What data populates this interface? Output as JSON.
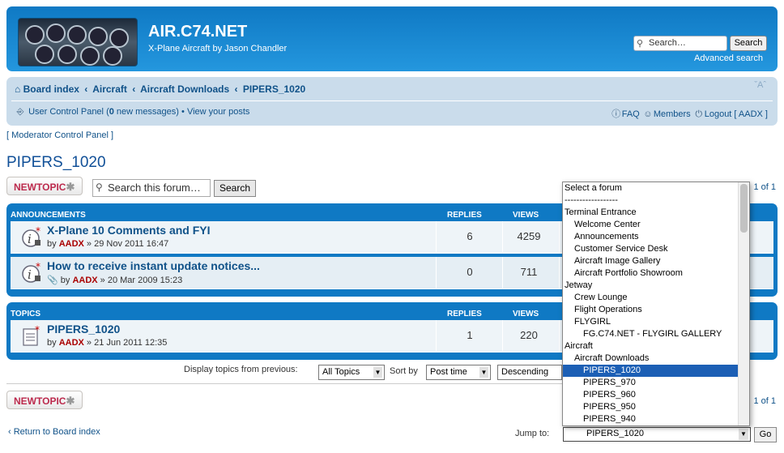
{
  "header": {
    "site_title": "AIR.C74.NET",
    "site_description": "X-Plane Aircraft by Jason Chandler",
    "search_placeholder": "Search…",
    "search_button": "Search",
    "advanced_search": "Advanced search",
    "brand_color": "#0f79c4"
  },
  "breadcrumbs": [
    "Board index",
    "Aircraft",
    "Aircraft Downloads",
    "PIPERS_1020"
  ],
  "font_size_control": "A",
  "nav": {
    "ucp": "User Control Panel",
    "messages_prefix": "(",
    "messages_count": "0",
    "messages_suffix": " new messages)",
    "view_posts": "View your posts",
    "faq": "FAQ",
    "members": "Members",
    "logout": "Logout [ AADX ]"
  },
  "mcp_link": "[ Moderator Control Panel ]",
  "page_title": "PIPERS_1020",
  "newtopic_label": "NEWTOPIC",
  "forum_search_placeholder": "Search this forum…",
  "forum_search_button": "Search",
  "page_of_top": "1 of 1",
  "page_of_bottom": "1 of 1",
  "announcements": {
    "header": "ANNOUNCEMENTS",
    "col_replies": "REPLIES",
    "col_views": "VIEWS",
    "rows": [
      {
        "title": "X-Plane 10 Comments and FYI",
        "by": "by ",
        "author": "AADX",
        "date": " » 29 Nov 2011 16:47",
        "replies": "6",
        "views": "4259"
      },
      {
        "title": "How to receive instant update notices...",
        "by": " by ",
        "author": "AADX",
        "date": " » 20 Mar 2009 15:23",
        "replies": "0",
        "views": "711"
      }
    ]
  },
  "topics": {
    "header": "TOPICS",
    "col_replies": "REPLIES",
    "col_views": "VIEWS",
    "rows": [
      {
        "title": "PIPERS_1020",
        "by": "by ",
        "author": "AADX",
        "date": " » 21 Jun 2011 12:35",
        "replies": "1",
        "views": "220"
      }
    ]
  },
  "display_bar": {
    "label": "Display topics from previous:",
    "topics_value": "All Topics",
    "sort_label": "Sort by",
    "sort_value": "Post time",
    "order_value": "Descending"
  },
  "return_link": "Return to Board index",
  "jump": {
    "label": "Jump to:",
    "selected": "PIPERS_1020",
    "go": "Go",
    "options": [
      {
        "label": "Select a forum",
        "level": 0
      },
      {
        "label": "------------------",
        "level": 0
      },
      {
        "label": "Terminal Entrance",
        "level": 0
      },
      {
        "label": "Welcome Center",
        "level": 1
      },
      {
        "label": "Announcements",
        "level": 1
      },
      {
        "label": "Customer Service Desk",
        "level": 1
      },
      {
        "label": "Aircraft Image Gallery",
        "level": 1
      },
      {
        "label": "Aircraft Portfolio Showroom",
        "level": 1
      },
      {
        "label": "Jetway",
        "level": 0
      },
      {
        "label": "Crew Lounge",
        "level": 1
      },
      {
        "label": "Flight Operations",
        "level": 1
      },
      {
        "label": "FLYGIRL",
        "level": 1
      },
      {
        "label": "FG.C74.NET - FLYGIRL GALLERY",
        "level": 2
      },
      {
        "label": "Aircraft",
        "level": 0
      },
      {
        "label": "Aircraft Downloads",
        "level": 1
      },
      {
        "label": "PIPERS_1020",
        "level": 2,
        "selected": true
      },
      {
        "label": "PIPERS_970",
        "level": 2
      },
      {
        "label": "PIPERS_960",
        "level": 2
      },
      {
        "label": "PIPERS_950",
        "level": 2
      },
      {
        "label": "PIPERS_940",
        "level": 2
      }
    ]
  }
}
